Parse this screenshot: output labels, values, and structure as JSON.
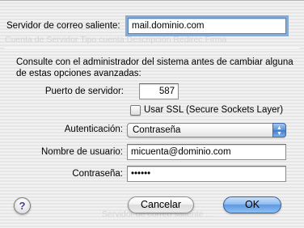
{
  "fields": {
    "outgoing_server_label": "Servidor de correo saliente:",
    "outgoing_server_value": "mail.dominio.com",
    "info_text_line1": "Consulte con el administrador del sistema antes de cambiar alguna",
    "info_text_line2": "de estas opciones avanzadas:",
    "port_label": "Puerto de servidor:",
    "port_value": "587",
    "ssl_label": "Usar SSL (Secure Sockets Layer)",
    "ssl_checked": false,
    "auth_label": "Autenticación:",
    "auth_selected": "Contraseña",
    "username_label": "Nombre de usuario:",
    "username_value": "micuenta@dominio.com",
    "password_label": "Contraseña:",
    "password_value": "••••••"
  },
  "buttons": {
    "help_label": "?",
    "cancel_label": "Cancelar",
    "ok_label": "OK"
  },
  "icons": {
    "help": "help-icon",
    "popup_arrows": "up-down-arrows-icon",
    "checkbox": "checkbox-icon"
  },
  "colors": {
    "focus_ring": "#86acd6",
    "default_button": "#5c98e2"
  }
}
